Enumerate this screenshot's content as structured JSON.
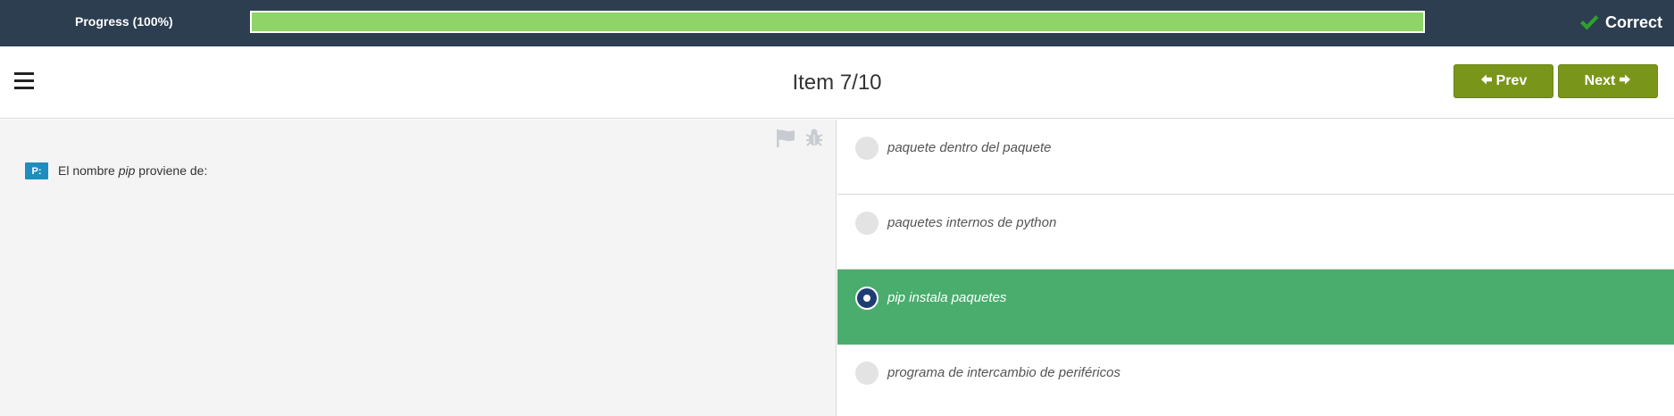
{
  "progress": {
    "label": "Progress (100%)",
    "value": 1.0
  },
  "status": {
    "label": "Correct",
    "icon": "check-icon",
    "color": "#2ea02e"
  },
  "header": {
    "title": "Item 7/10",
    "menu_icon": "menu-icon"
  },
  "nav": {
    "prev_label": "Prev",
    "next_label": "Next"
  },
  "question": {
    "badge": "P:",
    "text_before": "El nombre ",
    "text_emph": "pip",
    "text_after": " proviene de:"
  },
  "answers": [
    {
      "label": "paquete dentro del paquete",
      "selected": false
    },
    {
      "label": "paquetes internos de python",
      "selected": false
    },
    {
      "label": "pip instala paquetes",
      "selected": true
    },
    {
      "label": "programa de intercambio de periféricos",
      "selected": false
    }
  ],
  "colors": {
    "accent": "#7a961a",
    "selected": "#4aad6d",
    "topbar": "#2c3e50",
    "progress_fill": "#8fd468"
  }
}
